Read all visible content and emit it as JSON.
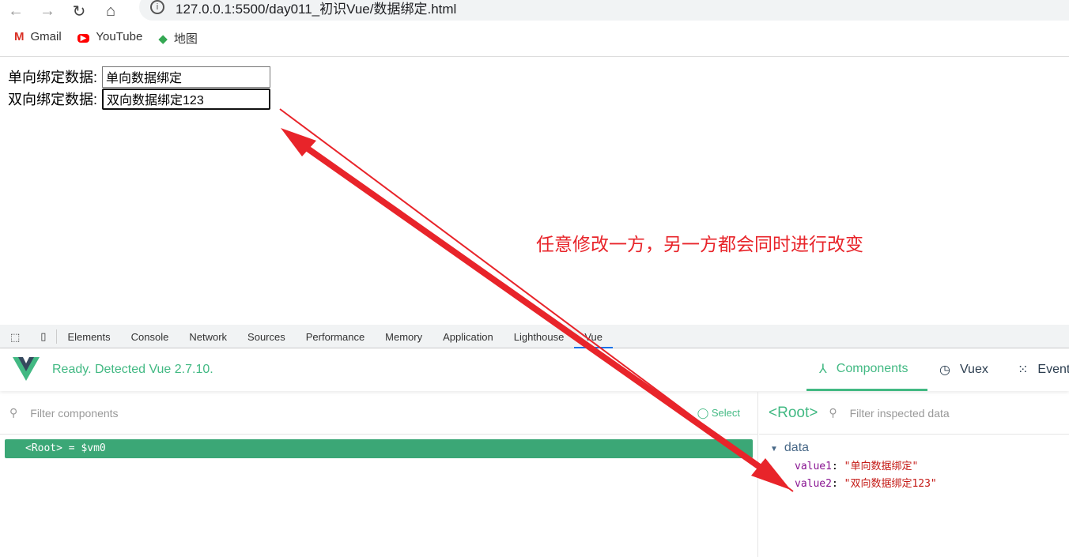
{
  "browser": {
    "url": "127.0.0.1:5500/day011_初识Vue/数据绑定.html",
    "bookmarks": [
      "Gmail",
      "YouTube",
      "地图"
    ]
  },
  "page": {
    "label1": "单向绑定数据:",
    "value1": "单向数据绑定",
    "label2": "双向绑定数据:",
    "value2": "双向数据绑定123"
  },
  "annotation": "任意修改一方，另一方都会同时进行改变",
  "devtools": {
    "tabs": [
      "Elements",
      "Console",
      "Network",
      "Sources",
      "Performance",
      "Memory",
      "Application",
      "Lighthouse",
      "Vue"
    ],
    "active_tab": "Vue"
  },
  "vue": {
    "status": "Ready. Detected Vue 2.7.10.",
    "nav": [
      "Components",
      "Vuex",
      "Events"
    ],
    "filter_placeholder": "Filter components",
    "select": "Select",
    "root_row": "<Root> = $vm0",
    "root_title": "<Root>",
    "inspect_placeholder": "Filter inspected data",
    "section": "data",
    "fields": [
      {
        "key": "value1",
        "value": "\"单向数据绑定\""
      },
      {
        "key": "value2",
        "value": "\"双向数据绑定123\""
      }
    ]
  },
  "colors": {
    "vue_green": "#42b983",
    "annotation_red": "#e8242a"
  }
}
